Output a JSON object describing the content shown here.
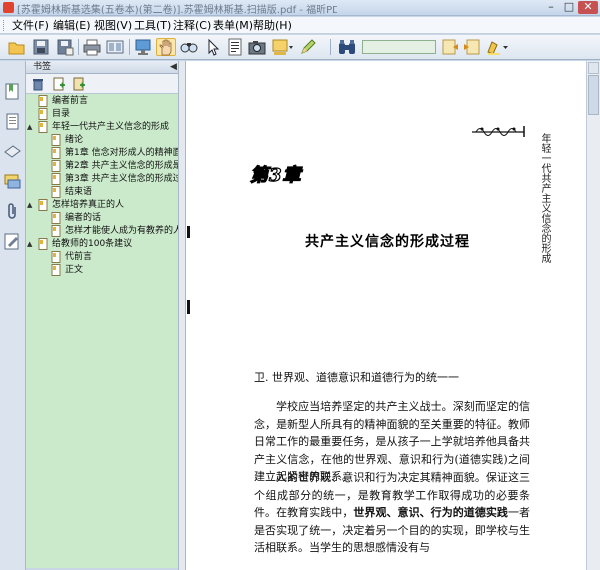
{
  "window": {
    "title": "[苏霍姆林斯基选集(五卷本)(第二卷)].苏霍姆林斯基.扫描版.pdf - 福昕PDF阅读器",
    "minimize": "–",
    "maximize": "□",
    "close": "✕"
  },
  "menubar": {
    "items": [
      "文件(F)",
      "编辑(E)",
      "视图(V)",
      "工具(T)",
      "注释(C)",
      "表单(M)",
      "帮助(H)"
    ]
  },
  "toolbar": {
    "icons": [
      "open-icon",
      "save-icon",
      "save-as-icon",
      "print-icon",
      "page-view-icon",
      "monitor-icon",
      "hand-tool-icon",
      "zoom-tool-icon",
      "select-arrow-icon",
      "text-select-icon",
      "snapshot-icon",
      "stamp-icon",
      "edit-icon",
      "binoculars-icon",
      "search-icon",
      "previous-result-icon",
      "next-result-icon",
      "highlight-icon"
    ],
    "search_value": ""
  },
  "sidebar": {
    "header": "书签",
    "collapse": "◀",
    "tools": [
      "delete-bookmark-icon",
      "add-bookmark-icon",
      "add-child-bookmark-icon"
    ],
    "bookmarks": [
      {
        "label": "编者前言",
        "level": 0,
        "toggle": ""
      },
      {
        "label": "目录",
        "level": 0,
        "toggle": ""
      },
      {
        "label": "年轻一代共产主义信念的形成",
        "level": 0,
        "toggle": "▲"
      },
      {
        "label": "绪论",
        "level": 1,
        "toggle": ""
      },
      {
        "label": "第1章 信念对形成人的精神面貌",
        "level": 1,
        "toggle": ""
      },
      {
        "label": "第2章 共产主义信念的形成是学",
        "level": 1,
        "toggle": ""
      },
      {
        "label": "第3章 共产主义信念的形成过程",
        "level": 1,
        "toggle": ""
      },
      {
        "label": "结束语",
        "level": 1,
        "toggle": ""
      },
      {
        "label": "怎样培养真正的人",
        "level": 0,
        "toggle": "▲"
      },
      {
        "label": "编者的话",
        "level": 1,
        "toggle": ""
      },
      {
        "label": "怎样才能使人成为有教养的人",
        "level": 1,
        "toggle": ""
      },
      {
        "label": "给教师的100条建议",
        "level": 0,
        "toggle": "▲"
      },
      {
        "label": "代前言",
        "level": 1,
        "toggle": ""
      },
      {
        "label": "正文",
        "level": 1,
        "toggle": ""
      }
    ]
  },
  "left_strip": [
    "bookmarks-panel-icon",
    "pages-panel-icon",
    "layers-panel-icon",
    "comments-panel-icon",
    "attachments-panel-icon",
    "signature-panel-icon"
  ],
  "document": {
    "running_head": "年轻一代共产主义信念的形成",
    "chapter_label": "第3章",
    "chapter_title": "共产主义信念的形成过程",
    "section_heading": "卫. 世界观、道德意识和道德行为的统一一",
    "paragraph1": "学校应当培养坚定的共产主义战士。深刻而坚定的信念，是新型人所具有的精神面貌的至关重要的特征。教师日常工作的最重要任务，是从孩子一上学就培养他具备共产主义信念，在他的世界观、意识和行为(道德实践)之间建立起紧密的联系。",
    "paragraph2_start": "人的世界观、意识和行为决定其精神面貌。保证这三个组成部分的统一，是教育教学工作取得成功的必要条件。在教育实践中，",
    "paragraph2_bold": "世界观、意识、行为的道德实践",
    "paragraph2_end": "一者是否实现了统一，决定着另一个目的的实现，即学校与生活相联系。当学生的思想感情没有与"
  }
}
